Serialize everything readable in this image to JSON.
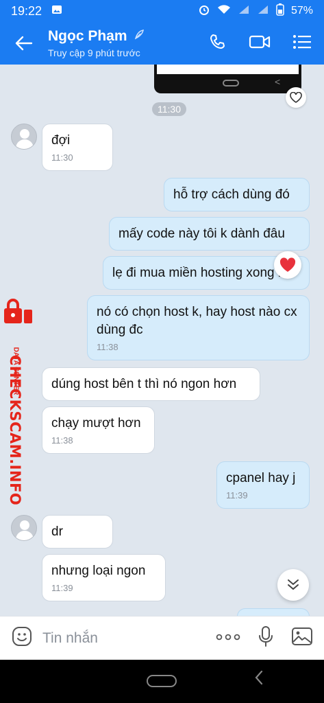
{
  "status_bar": {
    "time": "19:22",
    "battery": "57%"
  },
  "header": {
    "name": "Ngọc Phạm",
    "subtitle": "Truy cập 9 phút trước"
  },
  "chat": {
    "top_time": "11:30",
    "messages": [
      {
        "dir": "in",
        "text": "đợi",
        "time": "11:30"
      },
      {
        "dir": "out",
        "text": "hỗ trợ cách dùng đó"
      },
      {
        "dir": "out",
        "text": "mấy code này tôi k dành đâu"
      },
      {
        "dir": "out",
        "text": "lẹ đi mua miền hosting xong r"
      },
      {
        "dir": "out",
        "text": "nó có chọn host k, hay host nào cx dùng đc",
        "time": "11:38"
      },
      {
        "dir": "in",
        "text": "dúng host bên t thì nó ngon hơn"
      },
      {
        "dir": "in",
        "text": "chạy mượt hơn",
        "time": "11:38"
      },
      {
        "dir": "out",
        "text": "cpanel hay j",
        "time": "11:39"
      },
      {
        "dir": "in",
        "text": "dr"
      },
      {
        "dir": "in",
        "text": "nhưng loại ngon",
        "time": "11:39"
      }
    ]
  },
  "watermark": {
    "main": "CHECKSCAM.INFO",
    "small": "DATA CENTER"
  },
  "input": {
    "placeholder": "Tin nhắn"
  },
  "colors": {
    "header": "#1b7cf2",
    "outgoing": "#d6ecfb",
    "incoming": "#ffffff",
    "heart": "#e8323c"
  }
}
